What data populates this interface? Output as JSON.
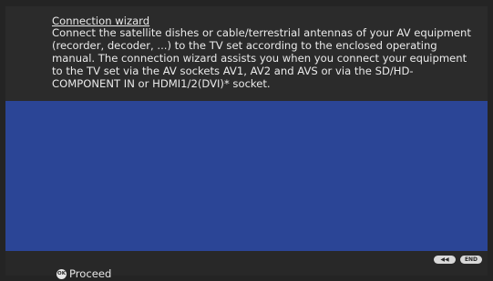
{
  "info_panel": {
    "title": "Connection wizard",
    "body": "Connect the satellite dishes or cable/terrestrial antennas of your AV equipment (recorder, decoder, ...) to the TV set according to the enclosed operating manual. The connection wizard assists you when you connect your equipment to the TV set via the AV sockets AV1, AV2 and AVS or via the SD/HD-COMPONENT IN or HDMI1/2(DVI)* socket."
  },
  "footer": {
    "ok_icon_text": "OK",
    "ok_label": "Proceed",
    "back_key_text": "◀◀",
    "end_key_text": "END"
  },
  "colors": {
    "background": "#242424",
    "info_panel": "#2b2b2b",
    "content_area": "#2b4596",
    "text": "#eaeaea"
  },
  "icons": [
    "ok-button-icon",
    "rewind-key-icon",
    "end-key-icon"
  ]
}
